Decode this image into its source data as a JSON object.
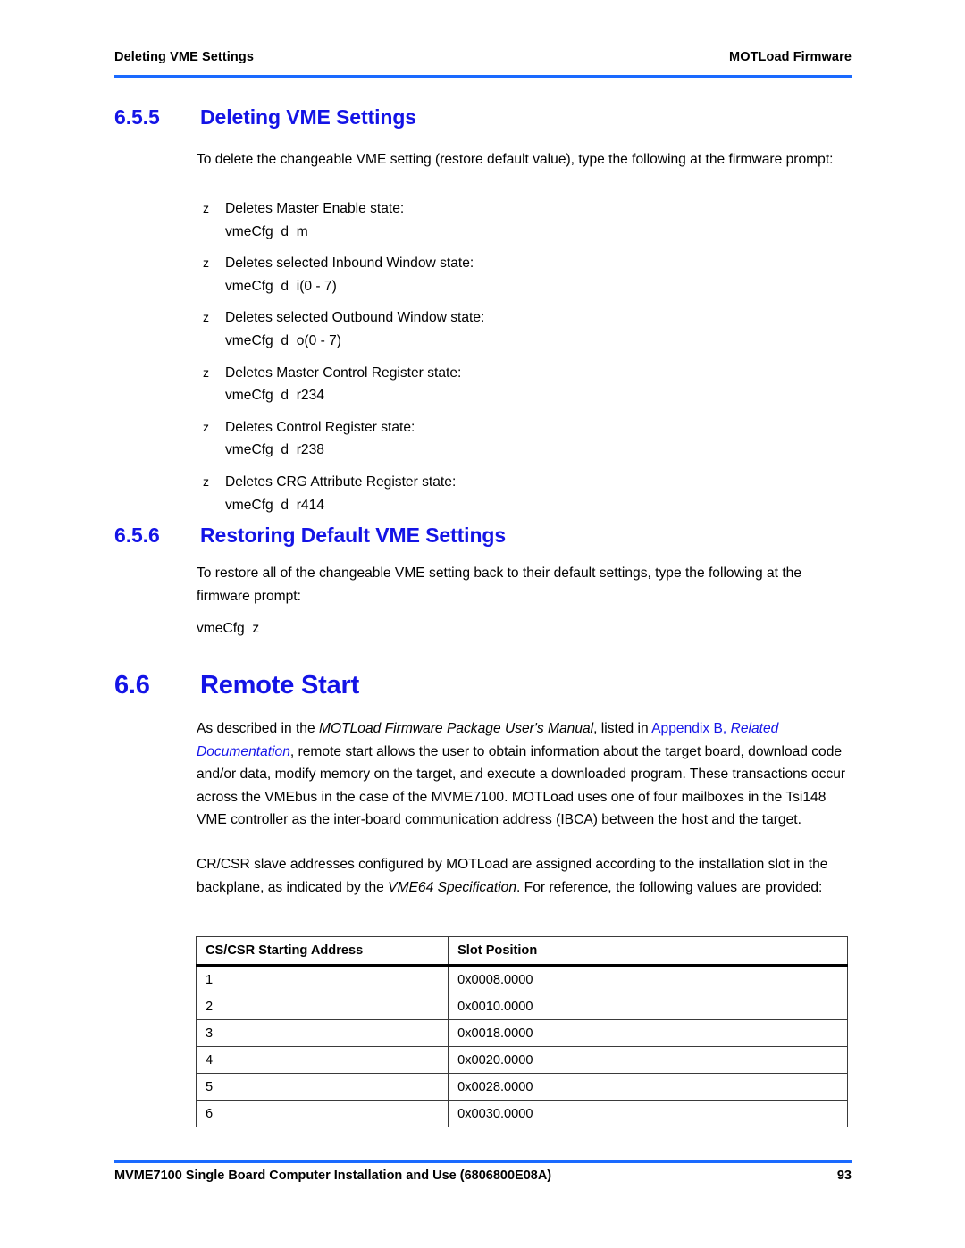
{
  "header": {
    "left": "Deleting VME Settings",
    "right": "MOTLoad Firmware",
    "rule_color": "#1A6AFF"
  },
  "heading_color": "#1414E6",
  "sections": {
    "deleting": {
      "number": "6.5.5",
      "title": "Deleting VME Settings",
      "intro": "To delete the changeable VME setting (restore default value), type the following at the firmware prompt:",
      "bullet_mark": "z",
      "items": [
        {
          "text": "Deletes Master Enable state:",
          "command": "vmeCfg  d  m"
        },
        {
          "text": "Deletes selected Inbound Window state:",
          "command": "vmeCfg  d  i(0 - 7)"
        },
        {
          "text": "Deletes selected Outbound Window state:",
          "command": "vmeCfg  d  o(0 - 7)"
        },
        {
          "text": "Deletes Master Control Register state:",
          "command": "vmeCfg  d  r234"
        },
        {
          "text": "Deletes Control Register state:",
          "command": "vmeCfg  d  r238"
        },
        {
          "text": "Deletes CRG Attribute Register state:",
          "command": "vmeCfg  d  r414"
        }
      ]
    },
    "restoring": {
      "number": "6.5.6",
      "title": "Restoring Default VME Settings",
      "intro": "To restore all of the changeable VME setting back to their default settings, type the following at the firmware prompt:",
      "command": "vmeCfg  z"
    },
    "remote_start": {
      "number": "6.6",
      "title": "Remote Start",
      "para1": {
        "t1": "As described in the ",
        "i1": "MOTLoad Firmware Package User's Manual",
        "t2": ", listed in ",
        "link1": "Appendix B,",
        "t3": " ",
        "link2": "Related Documentation",
        "t4": ", remote start allows the user to obtain information about the target board, download code and/or data, modify memory on the target, and execute a downloaded program. These transactions occur across the VMEbus in the case of the MVME7100. MOTLoad uses one of four mailboxes in the Tsi148 VME controller as the inter-board communication address (IBCA) between the host and the target."
      },
      "para2": {
        "t1": "CR/CSR slave addresses configured by MOTLoad are assigned according to the installation slot in the backplane, as indicated by the ",
        "i1": "VME64 Specification",
        "t2": ". For reference, the following values are provided:"
      },
      "table": {
        "columns": [
          "CS/CSR Starting Address",
          "Slot Position"
        ],
        "rows": [
          [
            "1",
            "0x0008.0000"
          ],
          [
            "2",
            "0x0010.0000"
          ],
          [
            "3",
            "0x0018.0000"
          ],
          [
            "4",
            "0x0020.0000"
          ],
          [
            "5",
            "0x0028.0000"
          ],
          [
            "6",
            "0x0030.0000"
          ]
        ]
      }
    }
  },
  "footer": {
    "left": "MVME7100 Single Board Computer Installation and Use (6806800E08A)",
    "page_number": "93"
  }
}
